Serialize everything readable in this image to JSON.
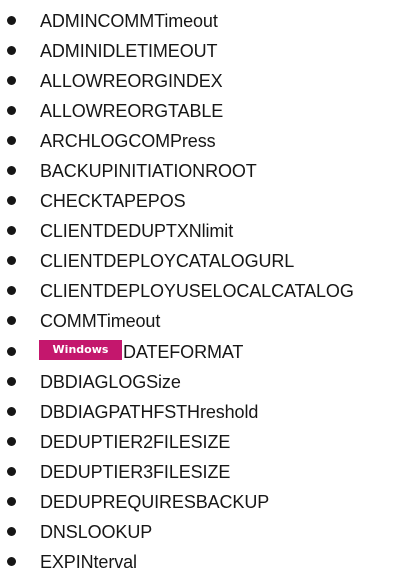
{
  "options": [
    {
      "label": "ADMINCOMMTimeout"
    },
    {
      "label": "ADMINIDLETIMEOUT"
    },
    {
      "label": "ALLOWREORGINDEX"
    },
    {
      "label": "ALLOWREORGTABLE"
    },
    {
      "label": "ARCHLOGCOMPress"
    },
    {
      "label": "BACKUPINITIATIONROOT"
    },
    {
      "label": "CHECKTAPEPOS"
    },
    {
      "label": "CLIENTDEDUPTXNlimit"
    },
    {
      "label": "CLIENTDEPLOYCATALOGURL"
    },
    {
      "label": "CLIENTDEPLOYUSELOCALCATALOG"
    },
    {
      "label": "COMMTimeout"
    },
    {
      "label": "DATEFORMAT",
      "badge": "Windows"
    },
    {
      "label": "DBDIAGLOGSize"
    },
    {
      "label": "DBDIAGPATHFSTHreshold"
    },
    {
      "label": "DEDUPTIER2FILESIZE"
    },
    {
      "label": "DEDUPTIER3FILESIZE"
    },
    {
      "label": "DEDUPREQUIRESBACKUP"
    },
    {
      "label": "DNSLOOKUP"
    },
    {
      "label": "EXPINterval"
    }
  ],
  "colors": {
    "text": "#161616",
    "badge_background": "#c4176d",
    "badge_text": "#ffffff"
  }
}
